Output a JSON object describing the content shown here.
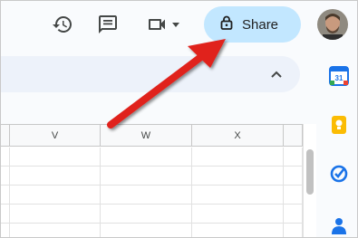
{
  "toolbar": {
    "history_icon": "history-icon",
    "comments_icon": "comment-icon",
    "meet_icon": "video-camera-icon",
    "meet_dropdown_icon": "caret-down-icon",
    "share": {
      "label": "Share",
      "icon": "lock-icon",
      "bg": "#c2e7ff"
    },
    "avatar_icon": "avatar"
  },
  "formula_bar": {
    "collapse_icon": "chevron-up-icon"
  },
  "sheet": {
    "columns": [
      "",
      "V",
      "W",
      "X",
      ""
    ],
    "rows": 5
  },
  "side_panel": {
    "items": [
      {
        "name": "calendar",
        "icon": "calendar-icon",
        "label": "31",
        "color": "#1a73e8"
      },
      {
        "name": "keep",
        "icon": "keep-icon",
        "color": "#fbbc04"
      },
      {
        "name": "tasks",
        "icon": "tasks-icon",
        "color": "#1a73e8"
      },
      {
        "name": "contacts",
        "icon": "contacts-icon",
        "color": "#1a73e8"
      }
    ]
  },
  "annotation": {
    "type": "red-arrow",
    "color": "#e0201b",
    "points_to": "share-button"
  }
}
